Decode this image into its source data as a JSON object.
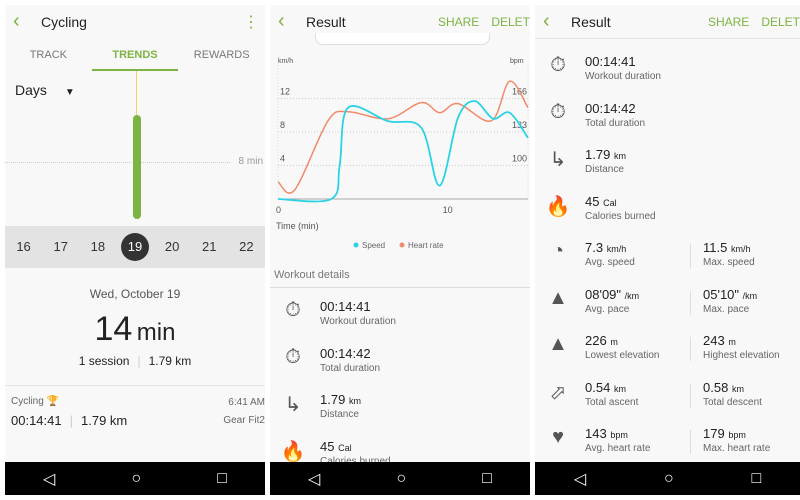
{
  "colors": {
    "accent": "#7cb342",
    "speed": "#29d3e3",
    "heart_rate": "#ef8b6a"
  },
  "panel1": {
    "title": "Cycling",
    "tabs": [
      "TRACK",
      "TRENDS",
      "REWARDS"
    ],
    "active_tab": "TRENDS",
    "period": "Days",
    "ref_label": "8 min",
    "bar_value_min": 14,
    "dates": [
      "16",
      "17",
      "18",
      "19",
      "20",
      "21",
      "22"
    ],
    "selected_date": "19",
    "date_title": "Wed, October 19",
    "duration_value": "14",
    "duration_unit": "min",
    "sessions": "1 session",
    "distance": "1.79 km",
    "session": {
      "type": "Cycling",
      "time": "6:41 AM",
      "duration": "00:14:41",
      "distance": "1.79 km",
      "device": "Gear Fit2",
      "icon": "trophy-icon"
    }
  },
  "panel2": {
    "title": "Result",
    "share": "SHARE",
    "delete": "DELETE",
    "chart_data": {
      "type": "line",
      "xlabel": "Time (min)",
      "ylabel_left": "km/h",
      "ylabel_right": "bpm",
      "xlim": [
        0,
        15
      ],
      "ylim_left": [
        0,
        16
      ],
      "ylim_right": [
        67,
        199
      ],
      "x_ticks": [
        "0",
        "10"
      ],
      "y_ticks_left": [
        "4",
        "8",
        "12"
      ],
      "y_ticks_right": [
        "100",
        "133",
        "166"
      ],
      "grid": true,
      "legend_position": "bottom",
      "series": [
        {
          "name": "Speed",
          "axis": "left",
          "x": [
            0,
            3.2,
            3.7,
            4.2,
            6.6,
            8.6,
            9.7,
            10.8,
            11.8,
            12.9,
            13.9,
            15
          ],
          "y": [
            0,
            0,
            4,
            10.9,
            9.3,
            8.5,
            1.6,
            9.7,
            11.7,
            9.6,
            10.3,
            7.3
          ]
        },
        {
          "name": "Heart rate",
          "axis": "right",
          "x": [
            0,
            1,
            3,
            4.2,
            6.6,
            8.6,
            9.7,
            10.8,
            12.8,
            13.9,
            15
          ],
          "y": [
            84,
            76,
            144,
            153,
            146,
            162,
            152,
            161,
            144,
            183,
            157
          ]
        }
      ]
    },
    "section": "Workout details",
    "items": [
      {
        "icon": "stopwatch-flame-icon",
        "value": "00:14:41",
        "label": "Workout duration"
      },
      {
        "icon": "stopwatch-icon",
        "value": "00:14:42",
        "label": "Total duration"
      },
      {
        "icon": "route-icon",
        "value": "1.79",
        "unit": "km",
        "label": "Distance"
      },
      {
        "icon": "flame-icon",
        "value": "45",
        "unit": "Cal",
        "label": "Calories burned"
      }
    ]
  },
  "panel3": {
    "title": "Result",
    "share": "SHARE",
    "delete": "DELETE",
    "items": [
      {
        "icon": "stopwatch-flame-icon",
        "value": "00:14:41",
        "label": "Workout duration"
      },
      {
        "icon": "stopwatch-icon",
        "value": "00:14:42",
        "label": "Total duration"
      },
      {
        "icon": "route-icon",
        "value": "1.79",
        "unit": "km",
        "label": "Distance"
      },
      {
        "icon": "flame-icon",
        "value": "45",
        "unit": "Cal",
        "label": "Calories burned"
      }
    ],
    "pairs": [
      {
        "icon": "speedometer-icon",
        "a": {
          "value": "7.3",
          "unit": "km/h",
          "label": "Avg. speed"
        },
        "b": {
          "value": "11.5",
          "unit": "km/h",
          "label": "Max. speed"
        }
      },
      {
        "icon": "road-icon",
        "a": {
          "value": "08'09\"",
          "unit": "/km",
          "label": "Avg. pace"
        },
        "b": {
          "value": "05'10\"",
          "unit": "/km",
          "label": "Max. pace"
        }
      },
      {
        "icon": "mountain-icon",
        "a": {
          "value": "226",
          "unit": "m",
          "label": "Lowest elevation"
        },
        "b": {
          "value": "243",
          "unit": "m",
          "label": "Highest elevation"
        }
      },
      {
        "icon": "arrow-up-right-icon",
        "a": {
          "value": "0.54",
          "unit": "km",
          "label": "Total ascent"
        },
        "b": {
          "value": "0.58",
          "unit": "km",
          "label": "Total descent"
        }
      },
      {
        "icon": "heart-rate-icon",
        "a": {
          "value": "143",
          "unit": "bpm",
          "label": "Avg. heart rate"
        },
        "b": {
          "value": "179",
          "unit": "bpm",
          "label": "Max. heart rate"
        }
      }
    ]
  }
}
